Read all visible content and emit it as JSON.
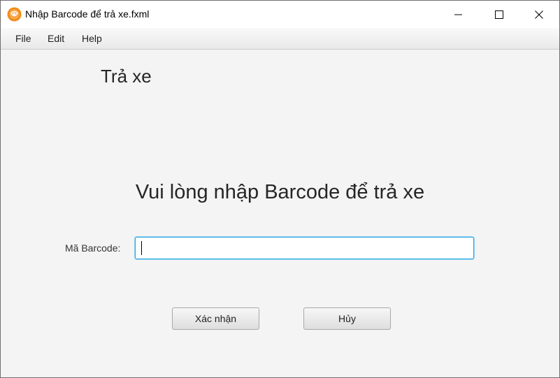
{
  "window": {
    "title": "Nhập Barcode để trả xe.fxml",
    "app_icon": "javafx-app-icon",
    "controls": [
      "minimize-icon",
      "maximize-icon",
      "close-icon"
    ]
  },
  "menubar": {
    "items": [
      {
        "label": "File"
      },
      {
        "label": "Edit"
      },
      {
        "label": "Help"
      }
    ]
  },
  "content": {
    "heading": "Trả xe",
    "prompt": "Vui lòng nhập Barcode để trả xe",
    "barcode_field": {
      "label": "Mã Barcode:",
      "value": "",
      "placeholder": ""
    },
    "confirm_label": "Xác nhận",
    "cancel_label": "Hủy"
  },
  "colors": {
    "focus_border": "#2aa7e0",
    "background": "#f4f4f4",
    "app_icon_orange": "#f28c1b"
  }
}
